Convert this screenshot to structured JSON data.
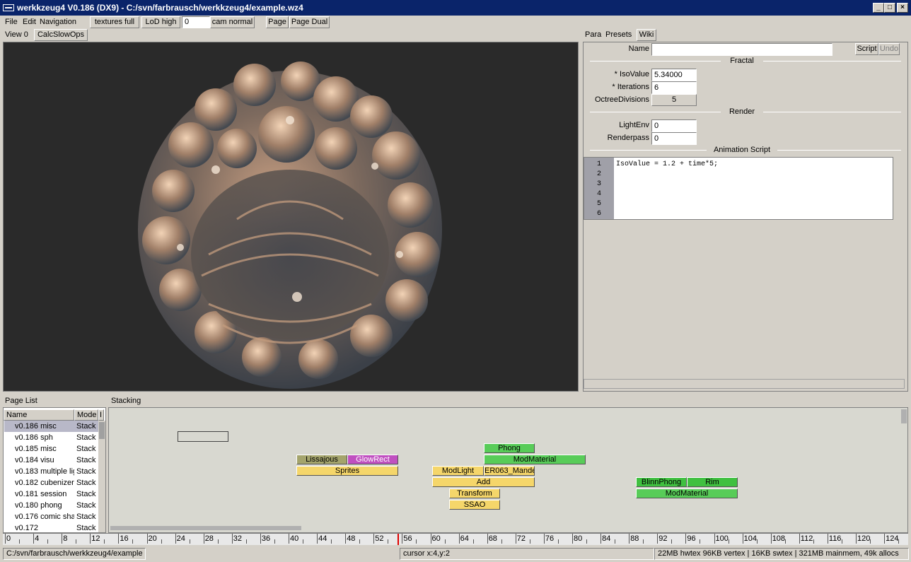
{
  "window": {
    "title": "werkkzeug4 V0.186 (DX9) - C:/svn/farbrausch/werkkzeug4/example.wz4",
    "min_glyph": "_",
    "max_glyph": "□",
    "close_glyph": "×"
  },
  "menu": [
    "File",
    "Edit",
    "Navigation"
  ],
  "toolbar": {
    "textures": "textures full",
    "lod": "LoD high",
    "frame_value": "0",
    "cam": "cam normal",
    "page": "Page",
    "page_dual": "Page Dual"
  },
  "view": {
    "tab_label": "View 0",
    "calc_button": "CalcSlowOps",
    "background": "#2a2a2a"
  },
  "params": {
    "tabs": [
      "Para",
      "Presets",
      "Wiki"
    ],
    "name_label": "Name",
    "name_value": "",
    "script_button": "Script",
    "undo_button": "Undo",
    "fractal_header": "Fractal",
    "isovalue_label": "* IsoValue",
    "isovalue_value": "5.34000",
    "iterations_label": "* Iterations",
    "iterations_value": "6",
    "octree_label": "OctreeDivisions",
    "octree_value": "5",
    "render_header": "Render",
    "lightenv_label": "LightEnv",
    "lightenv_value": "0",
    "renderpass_label": "Renderpass",
    "renderpass_value": "0",
    "anim_header": "Animation Script",
    "script_lines": [
      "1",
      "2",
      "3",
      "4",
      "5",
      "6"
    ],
    "script_code": "IsoValue = 1.2 + time*5;"
  },
  "pagelist": {
    "title": "Page List",
    "col_name": "Name",
    "col_mode": "Mode",
    "col_extra": "I",
    "rows": [
      {
        "name": "v0.186 misc",
        "mode": "Stack"
      },
      {
        "name": "v0.186 sph",
        "mode": "Stack"
      },
      {
        "name": "v0.185 misc",
        "mode": "Stack"
      },
      {
        "name": "v0.184 visu",
        "mode": "Stack"
      },
      {
        "name": "v0.183 multiple lig",
        "mode": "Stack"
      },
      {
        "name": "v0.182 cubenizer",
        "mode": "Stack"
      },
      {
        "name": "v0.181 session",
        "mode": "Stack"
      },
      {
        "name": "v0.180 phong",
        "mode": "Stack"
      },
      {
        "name": "v0.176 comic sha",
        "mode": "Stack"
      },
      {
        "name": "v0.172",
        "mode": "Stack"
      }
    ]
  },
  "stacking": {
    "title": "Stacking",
    "ops": {
      "lissajous": "Lissajous",
      "glowrect": "GlowRect",
      "sprites": "Sprites",
      "phong": "Phong",
      "modmaterial1": "ModMaterial",
      "modlight": "ModLight",
      "er063": "ER063_Mande",
      "add": "Add",
      "transform": "Transform",
      "ssao": "SSAO",
      "blinnphong": "BlinnPhong",
      "rim": "Rim",
      "modmaterial2": "ModMaterial"
    }
  },
  "timeline": {
    "labels": [
      "0",
      "4",
      "8",
      "12",
      "16",
      "20",
      "24",
      "28",
      "32",
      "36",
      "40",
      "44",
      "48",
      "52",
      "56",
      "60",
      "64",
      "68",
      "72",
      "76",
      "80",
      "84",
      "88",
      "92",
      "96",
      "100",
      "104",
      "108",
      "112",
      "116",
      "120",
      "124"
    ]
  },
  "status": {
    "path": "C:/svn/farbrausch/werkkzeug4/example",
    "cursor": "cursor x:4,y:2",
    "memory": "22MB hwtex  96KB vertex | 16KB swtex | 321MB mainmem, 49k allocs"
  }
}
